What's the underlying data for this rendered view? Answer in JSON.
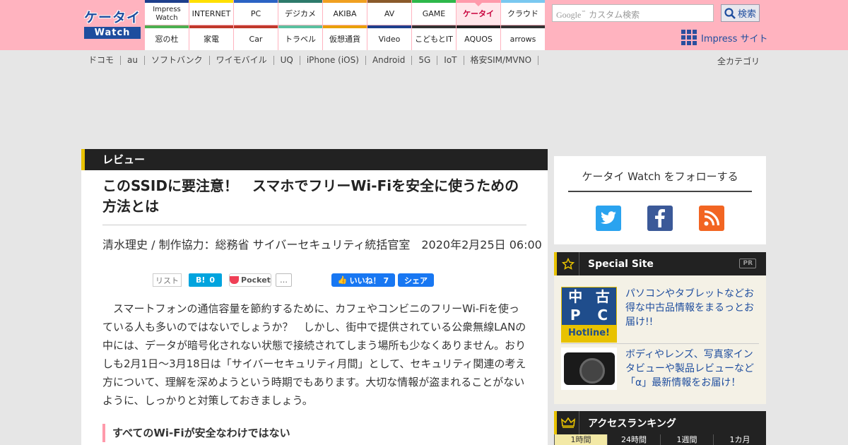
{
  "logo": {
    "top": "ケータイ",
    "bottom": "Watch"
  },
  "nav": [
    {
      "label": "Impress Watch",
      "color": "#1e3f8c"
    },
    {
      "label": "INTERNET",
      "color": "#ffe000"
    },
    {
      "label": "PC",
      "color": "#2a63c4"
    },
    {
      "label": "デジカメ",
      "color": "#2d7a6b"
    },
    {
      "label": "AKIBA",
      "color": "#f0a020"
    },
    {
      "label": "AV",
      "color": "#8a5a2a"
    },
    {
      "label": "GAME",
      "color": "#2db84a"
    },
    {
      "label": "ケータイ",
      "color": "#ff9aab",
      "active": true
    },
    {
      "label": "クラウド",
      "color": "#79c8f0"
    },
    {
      "label": "窓の杜",
      "color": "#4caf50"
    },
    {
      "label": "家電",
      "color": "#c0392b"
    },
    {
      "label": "Car",
      "color": "#c0392b"
    },
    {
      "label": "トラベル",
      "color": "#5bc0a0"
    },
    {
      "label": "仮想通貨",
      "color": "#e8a000"
    },
    {
      "label": "Video",
      "color": "#1e3f8c"
    },
    {
      "label": "こどもとIT",
      "color": "#333333"
    },
    {
      "label": "AQUOS",
      "color": "#222222"
    },
    {
      "label": "arrows",
      "color": "#333333"
    }
  ],
  "search": {
    "google": "Google",
    "tm": "™",
    "placeholder": "カスタム検索",
    "button": "検索"
  },
  "impress_site": "Impress サイト",
  "subnav": [
    "ドコモ",
    "au",
    "ソフトバンク",
    "ワイモバイル",
    "UQ",
    "iPhone (iOS)",
    "Android",
    "5G",
    "IoT",
    "格安SIM/MVNO"
  ],
  "all_categories": "全カテゴリ",
  "article": {
    "section": "レビュー",
    "title": "このSSIDに要注意！　スマホでフリーWi-Fiを安全に使うための方法とは",
    "byline": "清水理史 / 制作協力：総務省 サイバーセキュリティ統括官室　2020年2月25日 06:00",
    "share": {
      "list": "リスト",
      "hatena_logo": "B!",
      "hatena_count": "0",
      "pocket": "Pocket",
      "more": "…",
      "fb_like": "いいね！ 7",
      "fb_share": "シェア"
    },
    "body": "　スマートフォンの通信容量を節約するために、カフェやコンビニのフリーWi-Fiを使っている人も多いのではないでしょうか？　しかし、街中で提供されている公衆無線LANの中には、データが暗号化されない状態で接続されてしまう場所も少なくありません。おりしも2月1日～3月18日は「サイバーセキュリティ月間」として、セキュリティ関連の考え方について、理解を深めようという時期でもあります。大切な情報が盗まれることがないように、しっかりと対策しておきましょう。",
    "subhead": "すべてのWi-Fiが安全なわけではない"
  },
  "sidebar": {
    "follow_title": "ケータイ Watch をフォローする",
    "special_title": "Special Site",
    "pr": "PR",
    "special_items": [
      {
        "thumb": [
          "中",
          "古",
          "P",
          "C",
          "Hotline!"
        ],
        "text": "パソコンやタブレットなどお得な中古品情報をまるっとお届け!!"
      },
      {
        "text": "ボディやレンズ、写真家インタビューや製品レビューなど「α」最新情報をお届け！"
      }
    ],
    "ranking_title": "アクセスランキング",
    "ranking_tabs": [
      "1時間",
      "24時間",
      "1週間",
      "1カ月"
    ]
  }
}
